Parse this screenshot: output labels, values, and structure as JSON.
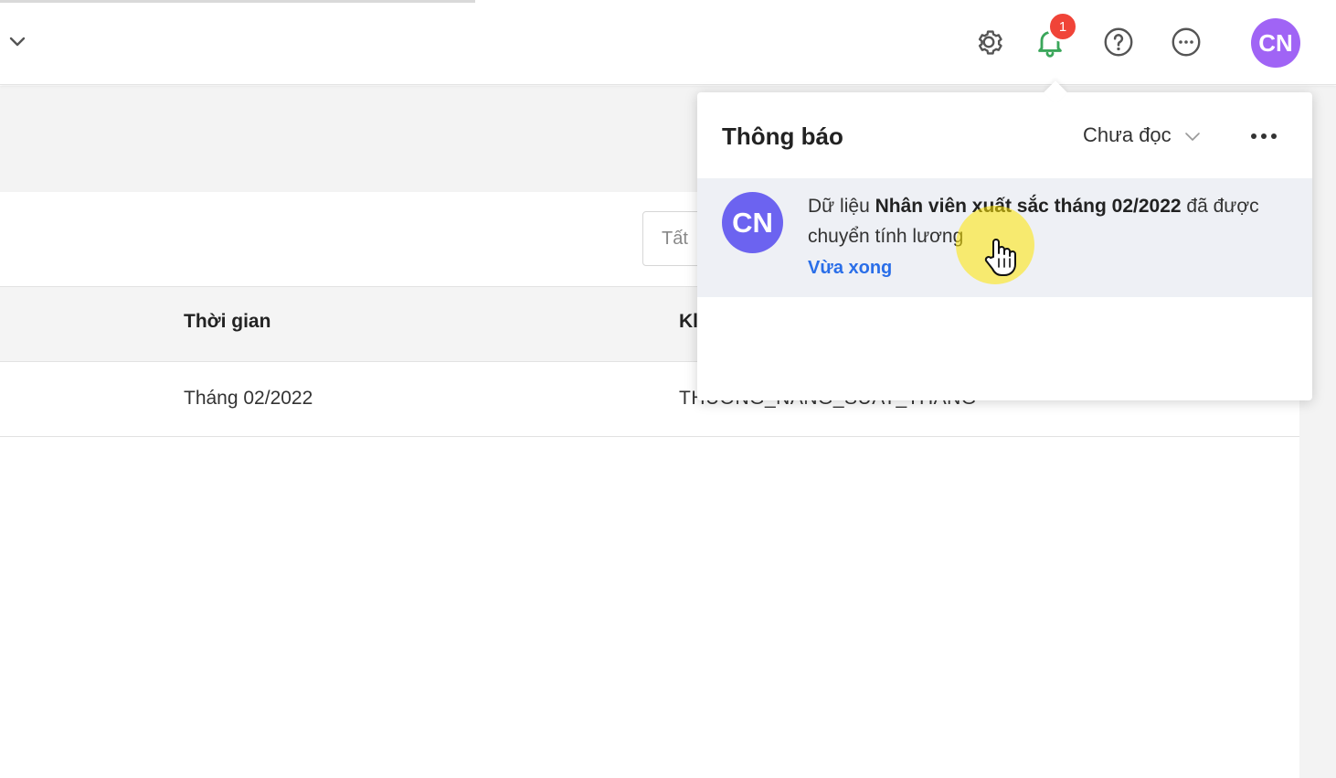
{
  "topbar": {
    "icons": [
      "chevron-down-icon",
      "gear-icon",
      "bell-icon",
      "help-icon",
      "more-options-icon"
    ],
    "notification_count": "1",
    "user_initials": "CN",
    "colors": {
      "bell": "#3aa65a",
      "badge": "#f04438",
      "avatar": "#a064f5"
    }
  },
  "filter": {
    "value": "Tất"
  },
  "table": {
    "headers": {
      "time": "Thời gian",
      "code": "Kl"
    },
    "rows": [
      {
        "time": "Tháng 02/2022",
        "code": "THUONG_NANG_SUAT_THANG"
      }
    ]
  },
  "notifications_panel": {
    "title": "Thông báo",
    "filter_label": "Chưa đọc",
    "items": [
      {
        "avatar_initials": "CN",
        "text_prefix": "Dữ liệu ",
        "text_bold": "Nhân viên xuất sắc tháng 02/2022",
        "text_suffix": " đã được chuyển tính lương",
        "time": "Vừa xong"
      }
    ],
    "colors": {
      "avatar": "#6c63f0",
      "time_link": "#2a6ee8",
      "item_bg": "#eef0f5"
    }
  }
}
